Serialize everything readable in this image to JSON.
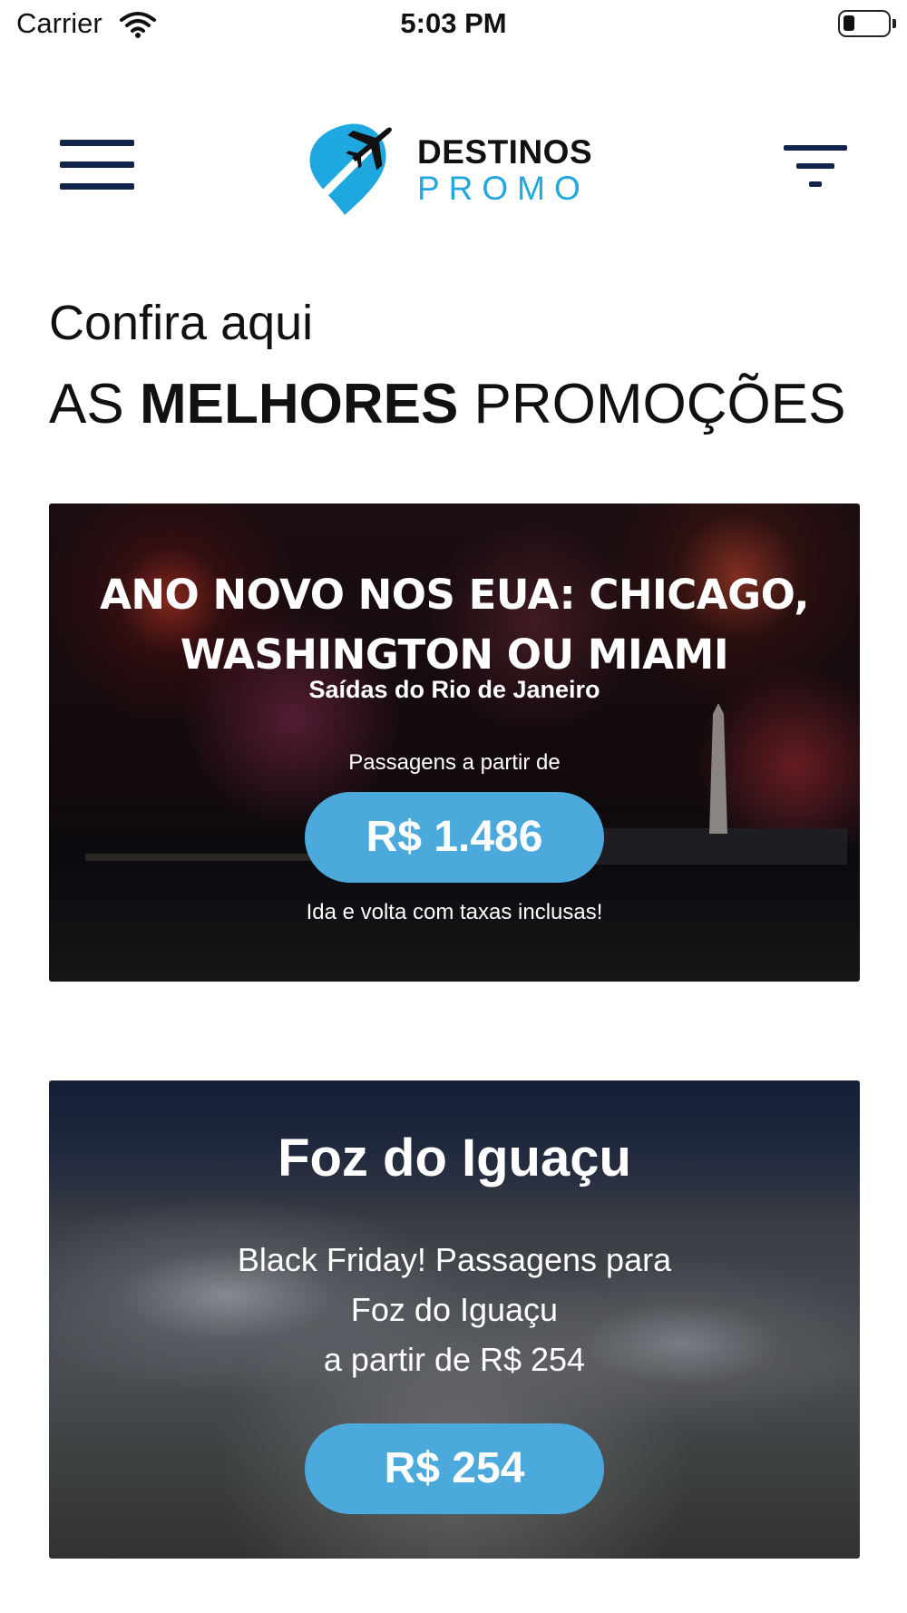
{
  "status_bar": {
    "carrier": "Carrier",
    "time": "5:03 PM",
    "icons": [
      "wifi-icon",
      "battery-icon"
    ]
  },
  "header": {
    "menu_icon": "hamburger-menu-icon",
    "filter_icon": "filter-icon",
    "logo": {
      "line1": "DESTINOS",
      "line2": "PROMO",
      "mark": "airplane-pin-icon"
    },
    "colors": {
      "navy": "#12234a",
      "brand_blue": "#22a8dd"
    }
  },
  "intro": {
    "line1": "Confira aqui",
    "line2_pre": "AS",
    "line2_bold": "MELHORES",
    "line2_post": "PROMOÇÕES"
  },
  "promos": [
    {
      "title_line1": "ANO NOVO NOS EUA: CHICAGO,",
      "title_line2": "WASHINGTON OU MIAMI",
      "subtitle": "Saídas do Rio de Janeiro",
      "from_label": "Passagens a partir de",
      "price": "R$ 1.486",
      "note": "Ida e volta com taxas inclusas!"
    },
    {
      "title": "Foz do Iguaçu",
      "desc_line1": "Black Friday! Passagens para",
      "desc_line2": "Foz do Iguaçu",
      "desc_line3": "a partir de R$ 254",
      "price": "R$ 254"
    }
  ],
  "accent_color": "#4ca9dc"
}
